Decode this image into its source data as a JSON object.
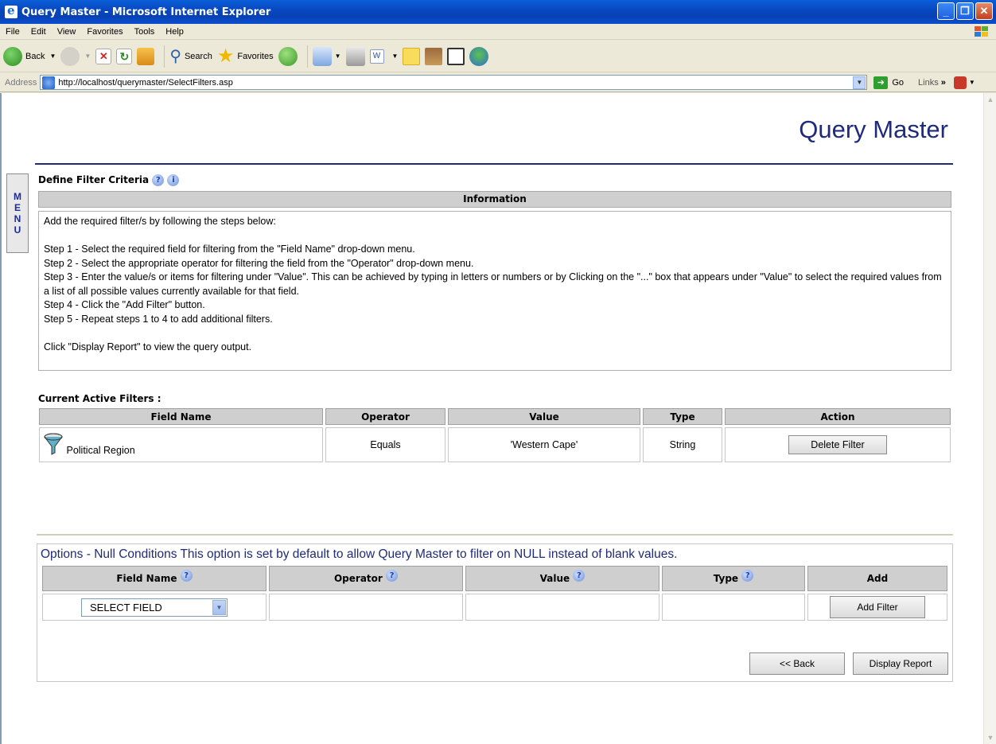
{
  "window": {
    "title": "Query Master - Microsoft Internet Explorer"
  },
  "menubar": [
    "File",
    "Edit",
    "View",
    "Favorites",
    "Tools",
    "Help"
  ],
  "toolbar": {
    "back": "Back",
    "search": "Search",
    "favorites": "Favorites"
  },
  "address": {
    "label": "Address",
    "url": "http://localhost/querymaster/SelectFilters.asp",
    "go": "Go",
    "links": "Links"
  },
  "page": {
    "title": "Query Master",
    "side_menu": [
      "M",
      "E",
      "N",
      "U"
    ],
    "define_title": "Define Filter Criteria",
    "info_header": "Information",
    "info_lines": [
      "Add the required filter/s by following the steps below:",
      "",
      "Step 1 - Select the required field for filtering from the \"Field Name\" drop-down menu.",
      "Step 2 - Select the appropriate operator for filtering the field from the \"Operator\" drop-down menu.",
      "Step 3 - Enter the value/s or items for filtering under \"Value\". This can be achieved by typing in letters or numbers or by Clicking on the \"...\" box that appears under \"Value\" to select the required values from a list of all possible values currently available for that field.",
      "Step 4 - Click the \"Add Filter\" button.",
      "Step 5 - Repeat steps 1 to 4 to add additional filters.",
      "",
      "Click \"Display Report\" to view the query output."
    ],
    "active_filters_title": "Current Active Filters :",
    "active_headers": [
      "Field Name",
      "Operator",
      "Value",
      "Type",
      "Action"
    ],
    "active_rows": [
      {
        "field": "Political Region",
        "operator": "Equals",
        "value": "'Western Cape'",
        "type": "String",
        "action": "Delete Filter"
      }
    ],
    "options_title": "Options - Null Conditions This option is set by default to allow Query Master to filter on NULL instead of blank values.",
    "options_headers": [
      "Field Name",
      "Operator",
      "Value",
      "Type",
      "Add"
    ],
    "select_field": "SELECT FIELD",
    "add_filter": "Add Filter",
    "back_button": "<< Back",
    "display_button": "Display Report"
  },
  "icons": {
    "help": "help-icon",
    "info": "info-icon",
    "filter": "filter-funnel-icon"
  }
}
